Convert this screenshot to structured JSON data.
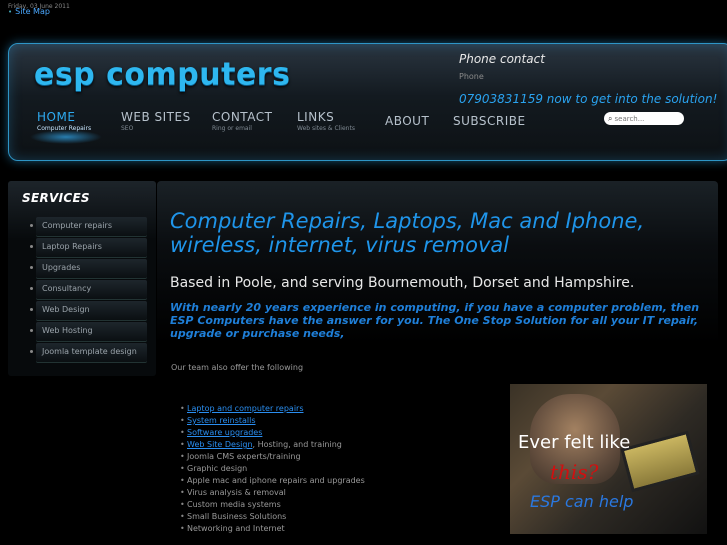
{
  "topbar": {
    "date": "Friday, 03 June 2011",
    "sitemap_label": "Site Map"
  },
  "header": {
    "logo_text": "esp computers",
    "phone_title": "Phone contact",
    "phone_label": "Phone",
    "phone_cta": "07903831159 now to get into the solution!"
  },
  "nav": [
    {
      "label": "HOME",
      "sub": "Computer Repairs",
      "active": true
    },
    {
      "label": "WEB SITES",
      "sub": "SEO"
    },
    {
      "label": "CONTACT",
      "sub": "Ring or email"
    },
    {
      "label": "LINKS",
      "sub": "Web sites & Clients"
    },
    {
      "label": "ABOUT",
      "sub": ""
    },
    {
      "label": "SUBSCRIBE",
      "sub": ""
    }
  ],
  "search": {
    "placeholder": "search..."
  },
  "sidebar": {
    "title": "SERVICES",
    "items": [
      "Computer repairs",
      "Laptop Repairs",
      "Upgrades",
      "Consultancy",
      "Web Design",
      "Web Hosting",
      "Joomla template design"
    ]
  },
  "main": {
    "heading": "Computer Repairs, Laptops, Mac and Iphone, wireless, internet, virus removal",
    "subheading": "Based in Poole, and serving Bournemouth, Dorset and Hampshire.",
    "tagline": "With nearly 20 years experience in computing, if you have a computer  problem, then ESP Computers have the answer for you. The One Stop Solution for all your IT repair, upgrade or purchase needs,",
    "intro": "Our team also offer the following",
    "services": [
      {
        "text": "Laptop and computer repairs",
        "link": true
      },
      {
        "text": "System reinstalls",
        "link": true
      },
      {
        "text": "Software upgrades",
        "link": true
      },
      {
        "text": "Web Site Design",
        "link": true,
        "suffix": ", Hosting, and training"
      },
      {
        "text": "Joomla CMS experts/training",
        "link": false
      },
      {
        "text": "Graphic design",
        "link": false
      },
      {
        "text": "Apple mac and iphone repairs and upgrades",
        "link": false
      },
      {
        "text": "Virus analysis &  removal",
        "link": false
      },
      {
        "text": "Custom media systems",
        "link": false
      },
      {
        "text": "Small Business Solutions",
        "link": false
      },
      {
        "text": "Networking and Internet",
        "link": false
      }
    ]
  },
  "promo": {
    "line1": "Ever felt like",
    "line2": "this?",
    "line3": "ESP can help"
  }
}
